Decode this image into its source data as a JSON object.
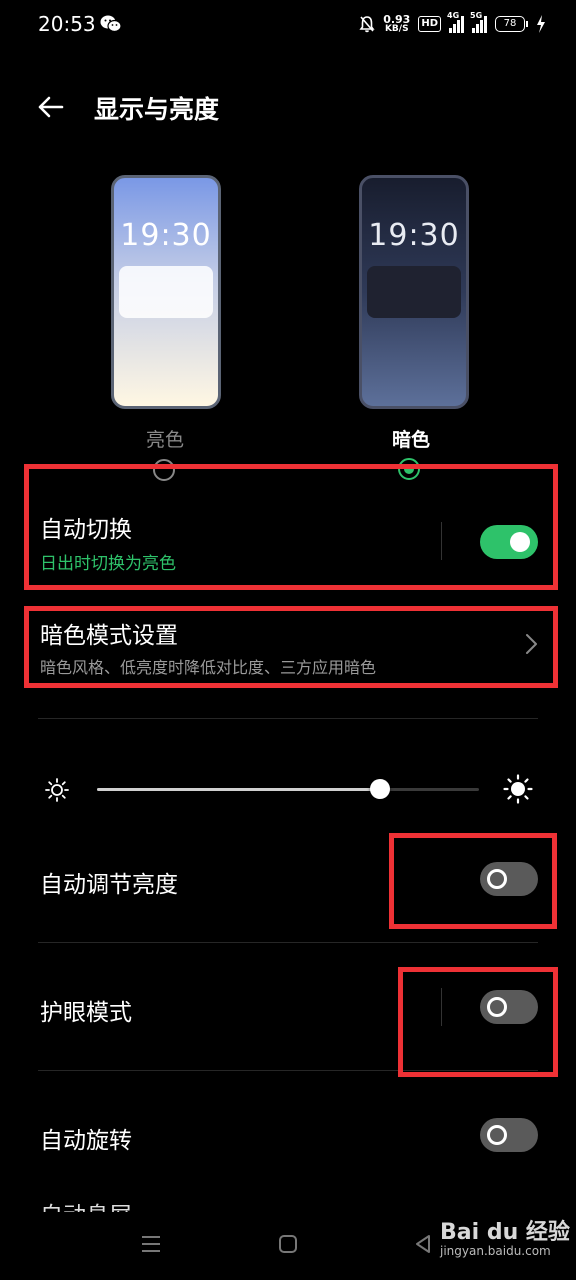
{
  "status_bar": {
    "time": "20:53",
    "net_speed_value": "0.93",
    "net_speed_unit": "KB/S",
    "hd_label": "HD",
    "sim1_label": "4G",
    "sim2_label": "5G",
    "battery": "78"
  },
  "header": {
    "title": "显示与亮度"
  },
  "theme": {
    "light": {
      "clock": "19:30",
      "label": "亮色",
      "selected": false
    },
    "dark": {
      "clock": "19:30",
      "label": "暗色",
      "selected": true
    }
  },
  "auto_switch": {
    "title": "自动切换",
    "subtitle": "日出时切换为亮色",
    "enabled": true
  },
  "dark_mode_settings": {
    "title": "暗色模式设置",
    "subtitle": "暗色风格、低亮度时降低对比度、三方应用暗色"
  },
  "brightness": {
    "level": 0.74
  },
  "auto_brightness": {
    "title": "自动调节亮度",
    "enabled": false
  },
  "eye_comfort": {
    "title": "护眼模式",
    "enabled": false
  },
  "auto_rotate": {
    "title": "自动旋转",
    "enabled": false
  },
  "next_item": {
    "title": "自动息屏"
  },
  "watermark": {
    "logo": "Bai du 经验",
    "url": "jingyan.baidu.com"
  },
  "colors": {
    "accent": "#2ec26a",
    "annotation": "#ee3135"
  }
}
